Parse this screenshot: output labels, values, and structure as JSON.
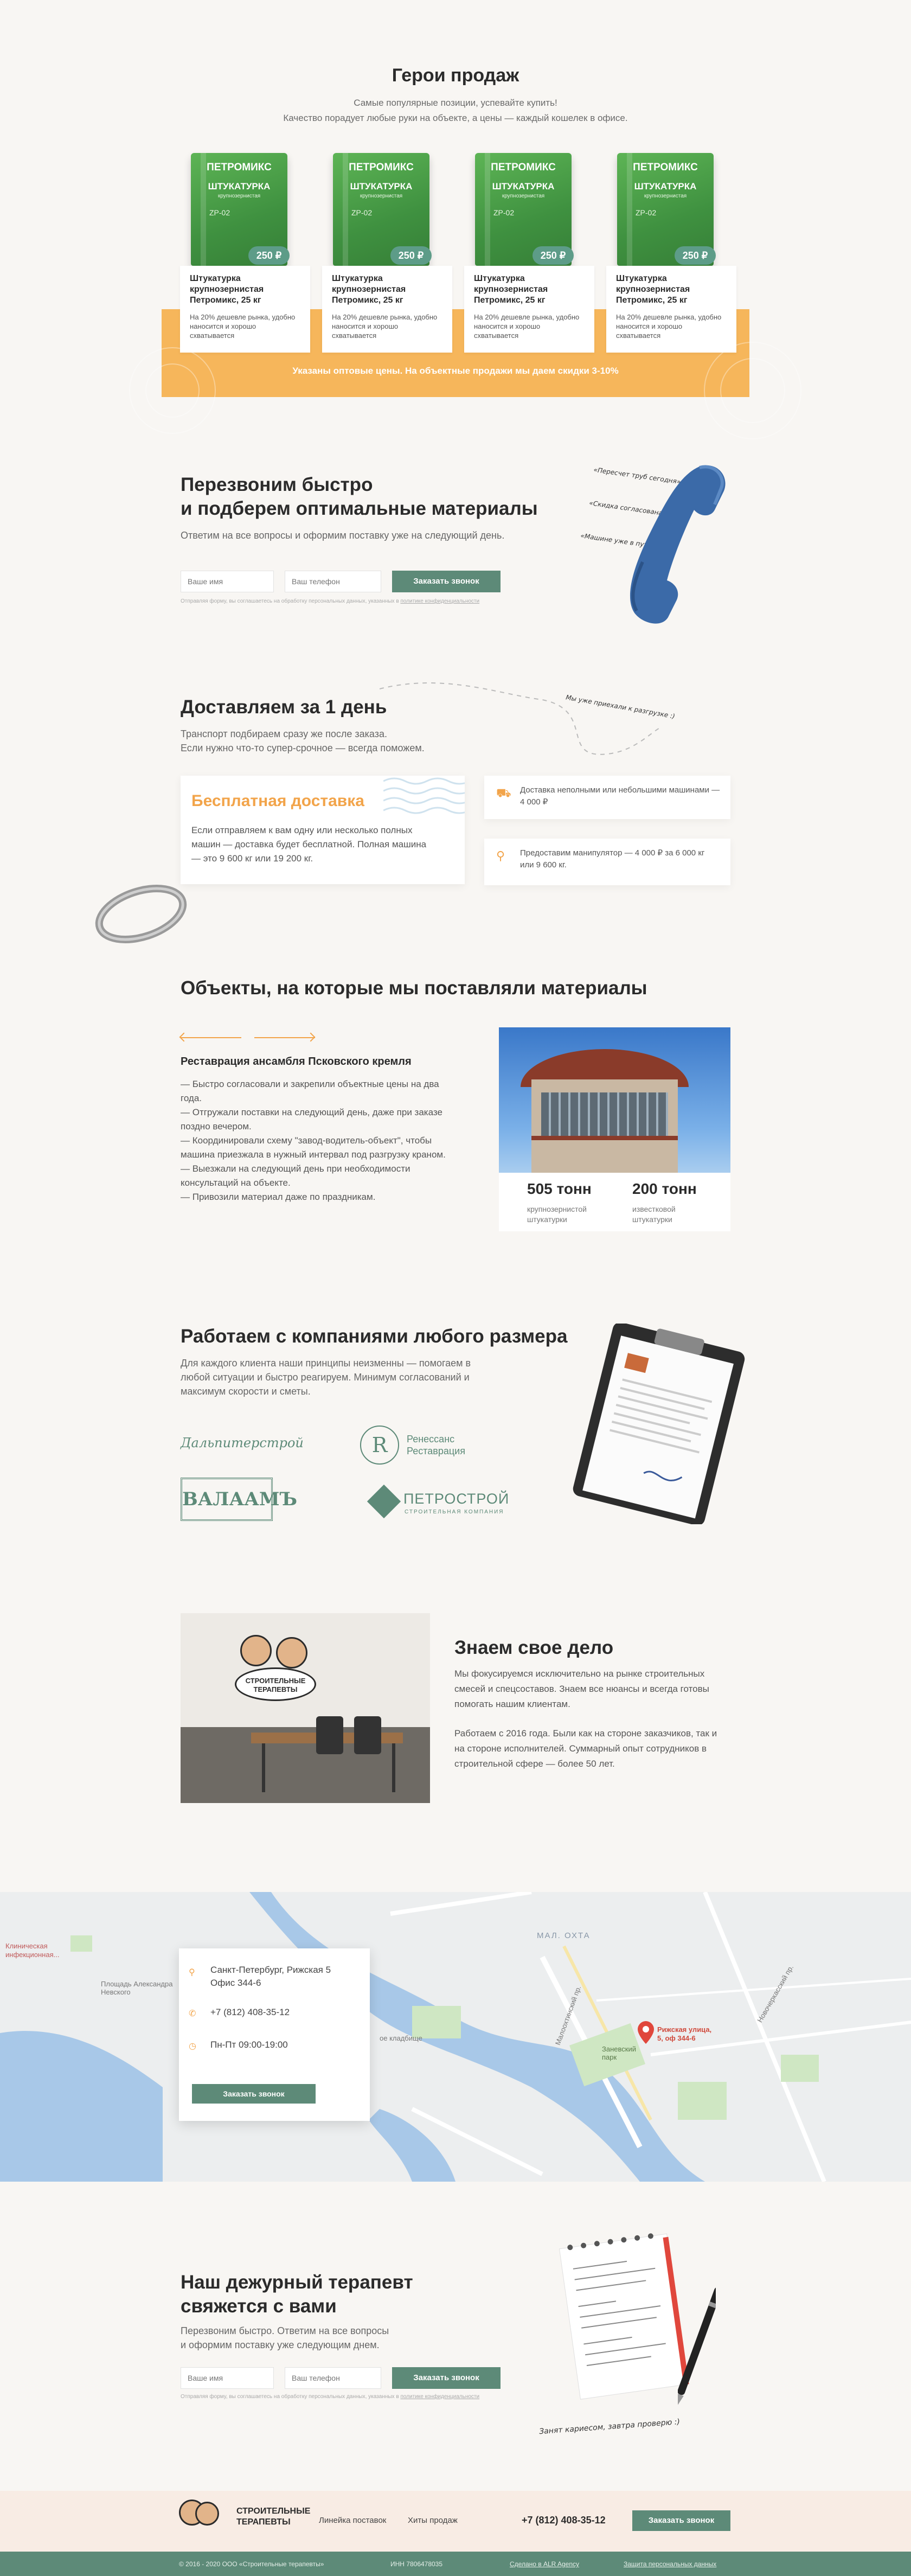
{
  "heroes": {
    "title": "Герои продаж",
    "subtitle_1": "Самые популярные позиции, успевайте купить!",
    "subtitle_2": "Качество порадует любые руки на объекте, а цены — каждый кошелек в офисе.",
    "note": "Указаны оптовые цены. На объектные продажи мы даем скидки 3-10%",
    "products": [
      {
        "brand": "ПЕТРОМИКС",
        "bag_title": "ШТУКАТУРКА",
        "bag_sub": "крупнозернистая",
        "code": "ZP-02",
        "price": "250 ₽",
        "name": "Штукатурка крупнозернистая Петромикс, 25 кг",
        "desc": "На 20% дешевле рынка, удобно наносится и хорошо схватывается"
      },
      {
        "brand": "ПЕТРОМИКС",
        "bag_title": "ШТУКАТУРКА",
        "bag_sub": "крупнозернистая",
        "code": "ZP-02",
        "price": "250 ₽",
        "name": "Штукатурка крупнозернистая Петромикс, 25 кг",
        "desc": "На 20% дешевле рынка, удобно наносится и хорошо схватывается"
      },
      {
        "brand": "ПЕТРОМИКС",
        "bag_title": "ШТУКАТУРКА",
        "bag_sub": "крупнозернистая",
        "code": "ZP-02",
        "price": "250 ₽",
        "name": "Штукатурка крупнозернистая Петромикс, 25 кг",
        "desc": "На 20% дешевле рынка, удобно наносится и хорошо схватывается"
      },
      {
        "brand": "ПЕТРОМИКС",
        "bag_title": "ШТУКАТУРКА",
        "bag_sub": "крупнозернистая",
        "code": "ZP-02",
        "price": "250 ₽",
        "name": "Штукатурка крупнозернистая Петромикс, 25 кг",
        "desc": "На 20% дешевле рынка, удобно наносится и хорошо схватывается"
      }
    ]
  },
  "callback": {
    "title_1": "Перезвоним быстро",
    "title_2": "и подберем оптимальные материалы",
    "lead": "Ответим на все вопросы и оформим поставку уже на следующий день.",
    "name_placeholder": "Ваше имя",
    "phone_placeholder": "Ваш телефон",
    "button": "Заказать звонок",
    "fine": "Отправляя форму, вы соглашаетесь на обработку персональных данных, указанных в",
    "fine_link": "политике конфиденциальности",
    "notes": [
      "«Пересчет труб сегодня»",
      "«Скидка согласована»",
      "«Машине уже в пути»"
    ]
  },
  "delivery": {
    "title": "Доставляем за 1 день",
    "lead_1": "Транспорт подбираем сразу же после заказа.",
    "lead_2": "Если нужно что-то супер-срочное — всегда поможем.",
    "path_note": "Мы уже приехали к разгрузке :)",
    "free_title": "Бесплатная доставка",
    "free_text": "Если отправляем к вам одну или несколько полных машин — доставка будет бесплатной. Полная машина — это 9 600 кг или 19 200 кг.",
    "features": [
      {
        "icon": "truck-icon",
        "text": "Доставка неполными или небольшими машинами — 4 000 ₽"
      },
      {
        "icon": "crane-icon",
        "text": "Предоставим манипулятор — 4 000 ₽ за 6 000 кг или 9 600 кг."
      }
    ]
  },
  "objects": {
    "title": "Объекты, на которые мы поставляли материалы",
    "project_title": "Реставрация ансамбля Псковского кремля",
    "items": [
      "— Быстро согласовали и закрепили объектные цены на два года.",
      "— Отгружали поставки на следующий день, даже при заказе поздно вечером.",
      "— Координировали схему \"завод-водитель-объект\", чтобы машина приезжала в нужный интервал под разгрузку краном.",
      "— Выезжали на следующий день при необходимости консультаций на объекте.",
      "— Привозили материал даже по праздникам."
    ],
    "stats": [
      {
        "value": "505 тонн",
        "label": "крупнозернистой штукатурки"
      },
      {
        "value": "200 тонн",
        "label": "известковой штукатурки"
      }
    ]
  },
  "partners": {
    "title": "Работаем с компаниями любого размера",
    "lead": "Для каждого клиента наши принципы неизменны — помогаем в любой ситуации и быстро реагируем. Минимум согласований и максимум скорости и сметы.",
    "logos": [
      "Дальпитерстрой",
      "Ренессанс Реставрация",
      "ВАЛААМЪ",
      "ПЕТРОСТРОЙ"
    ],
    "logo_sub": [
      "",
      "",
      "",
      "СТРОИТЕЛЬНАЯ КОМПАНИЯ"
    ]
  },
  "about": {
    "title": "Знаем свое дело",
    "p1": "Мы фокусируемся исключительно на рынке строительных смесей и спецсоставов. Знаем все нюансы и всегда готовы помогать нашим клиентам.",
    "p2": "Работаем с 2016 года. Были как на стороне заказчиков, так и на стороне исполнителей. Суммарный опыт сотрудников в строительной сфере — более 50 лет.",
    "sign_1": "СТРОИТЕЛЬНЫЕ",
    "sign_2": "ТЕРАПЕВТЫ"
  },
  "map": {
    "address_1": "Санкт-Петербург, Рижская 5",
    "address_2": "Офис 344-6",
    "phone": "+7 (812) 408-35-12",
    "hours": "Пн-Пт 09:00-19:00",
    "button": "Заказать звонок",
    "pin_label_1": "Рижская улица,",
    "pin_label_2": "5, оф 344-6",
    "district": "МАЛ. ОХТА",
    "park": "Заневский парк",
    "clinic_1": "Клиническая",
    "clinic_2": "инфекционная...",
    "square": "Площадь Александра Невского",
    "cemetery": "ое кладбище",
    "street_1": "Малоохтинский пр.",
    "street_2": "Новочеркасский пр."
  },
  "contact": {
    "title_1": "Наш дежурный терапевт",
    "title_2": "свяжется с вами",
    "lead_1": "Перезвоним быстро. Ответим на все вопросы",
    "lead_2": "и оформим поставку уже следующим днем.",
    "name_placeholder": "Ваше имя",
    "phone_placeholder": "Ваш телефон",
    "button": "Заказать звонок",
    "fine": "Отправляя форму, вы соглашаетесь на обработку персональных данных, указанных в",
    "fine_link": "политике конфиденциальности",
    "notepad_caption": "Занят кариесом, завтра проверю :)"
  },
  "footer": {
    "logo_1": "СТРОИТЕЛЬНЫЕ",
    "logo_2": "ТЕРАПЕВТЫ",
    "nav": [
      "Линейка поставок",
      "Хиты продаж"
    ],
    "phone": "+7 (812) 408-35-12",
    "button": "Заказать звонок",
    "copyright": "© 2016 - 2020 ООО «Строительные терапевты»",
    "inn": "ИНН 7806478035",
    "made_by": "Сделано в ALR Agency",
    "privacy": "Защита персональных данных"
  },
  "colors": {
    "accent": "#f2a44a",
    "brand_green": "#5d8a78",
    "bag_green": "#4aa047",
    "background": "#f8f6f3"
  }
}
